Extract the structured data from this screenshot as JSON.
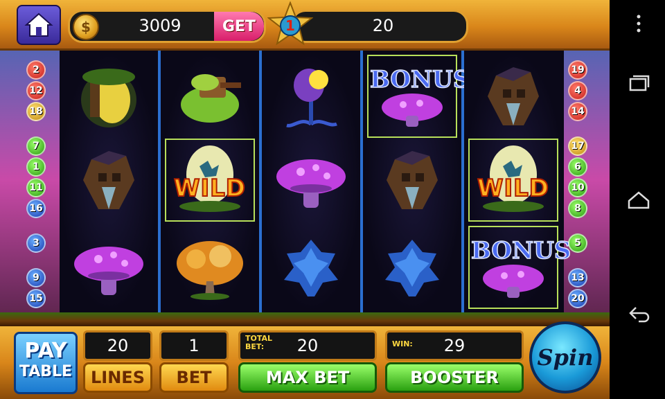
{
  "top": {
    "coins": "3009",
    "get_label": "GET",
    "level": "1",
    "level_value": "20"
  },
  "lines_left": [
    {
      "n": "2",
      "c": "red"
    },
    {
      "n": "12",
      "c": "red"
    },
    {
      "n": "18",
      "c": "yellow"
    },
    {
      "n": "7",
      "c": "green"
    },
    {
      "n": "1",
      "c": "green"
    },
    {
      "n": "11",
      "c": "green"
    },
    {
      "n": "16",
      "c": "blue"
    },
    {
      "n": "3",
      "c": "blue"
    },
    {
      "n": "9",
      "c": "blue"
    },
    {
      "n": "15",
      "c": "blue"
    }
  ],
  "lines_right": [
    {
      "n": "19",
      "c": "red"
    },
    {
      "n": "4",
      "c": "red"
    },
    {
      "n": "14",
      "c": "red"
    },
    {
      "n": "17",
      "c": "yellow"
    },
    {
      "n": "6",
      "c": "green"
    },
    {
      "n": "10",
      "c": "green"
    },
    {
      "n": "8",
      "c": "green"
    },
    {
      "n": "5",
      "c": "green"
    },
    {
      "n": "13",
      "c": "blue"
    },
    {
      "n": "20",
      "c": "blue"
    }
  ],
  "reels": [
    [
      "treehouse-icon",
      "cabin-icon",
      "mushroom-pink-icon"
    ],
    [
      "green-house-icon",
      "wild-egg-icon",
      "golden-tree-icon"
    ],
    [
      "flower-icon",
      "mushroom-pink-icon",
      "blue-tree-icon"
    ],
    [
      "bonus-mushroom-icon",
      "cabin-icon",
      "blue-tree-icon"
    ],
    [
      "cabin-icon",
      "wild-egg-icon",
      "bonus-mushroom-icon"
    ]
  ],
  "highlighted": [
    [
      1,
      1
    ],
    [
      3,
      0
    ],
    [
      4,
      1
    ],
    [
      4,
      2
    ]
  ],
  "symbols": {
    "wild_label": "WILD",
    "bonus_label": "BONUS"
  },
  "bottom": {
    "pay_line1": "PAY",
    "pay_line2": "TABLE",
    "lines_value": "20",
    "lines_label": "LINES",
    "bet_value": "1",
    "bet_label": "BET",
    "total_bet_label1": "TOTAL",
    "total_bet_label2": "BET:",
    "total_bet_value": "20",
    "max_bet_label": "MAX BET",
    "win_label": "WIN:",
    "win_value": "29",
    "booster_label": "BOOSTER",
    "spin_label": "Spin"
  }
}
